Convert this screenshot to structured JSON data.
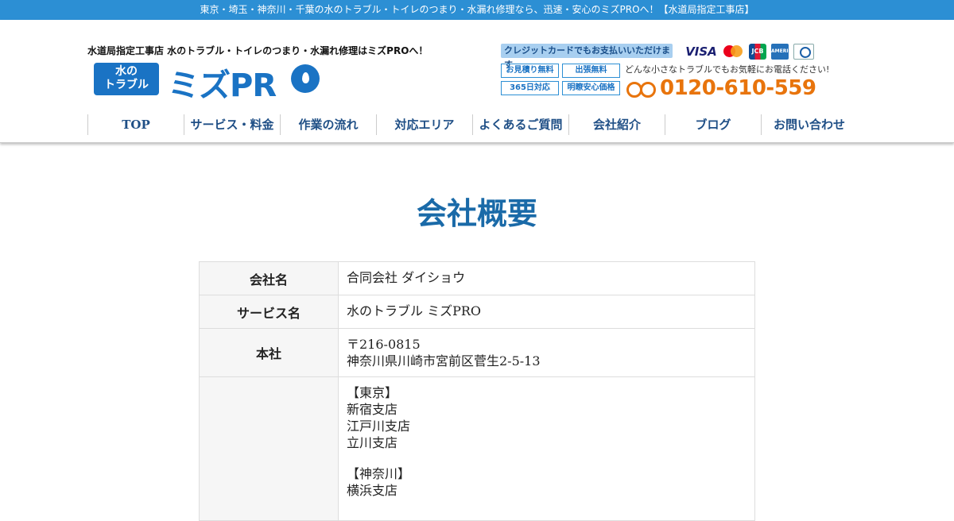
{
  "topbar": {
    "text": "東京・埼玉・神奈川・千葉の水のトラブル・トイレのつまり・水漏れ修理なら、迅速・安心のミズPROへ！【水道局指定工事店】"
  },
  "header": {
    "tagline": "水道局指定工事店 水のトラブル・トイレのつまり・水漏れ修理はミズPROへ！",
    "logo": {
      "box_line1": "水の",
      "box_line2": "トラブル",
      "text": "ミズPR"
    },
    "card_banner": "クレジットカードでもお支払いいただけます",
    "cards": [
      {
        "name": "visa-icon",
        "label": "VISA"
      },
      {
        "name": "mastercard-icon",
        "label": ""
      },
      {
        "name": "jcb-icon",
        "label": "JCB"
      },
      {
        "name": "amex-icon",
        "label": "AMERICAN EXPRESS"
      },
      {
        "name": "diners-icon",
        "label": ""
      }
    ],
    "badges": [
      "お見積り無料",
      "出張無料",
      "365日対応",
      "明瞭安心価格"
    ],
    "phone_note": "どんな小さなトラブルでもお気軽にお電話ください!",
    "phone": "0120-610-559"
  },
  "nav": [
    "TOP",
    "サービス・料金",
    "作業の流れ",
    "対応エリア",
    "よくあるご質問",
    "会社紹介",
    "ブログ",
    "お問い合わせ"
  ],
  "main": {
    "title": "会社概要",
    "rows": [
      {
        "label": "会社名",
        "lines": [
          "合同会社 ダイショウ"
        ]
      },
      {
        "label": "サービス名",
        "lines": [
          "水のトラブル ミズPRO"
        ]
      },
      {
        "label": "本社",
        "lines": [
          "〒216-0815",
          "神奈川県川崎市宮前区菅生2-5-13"
        ]
      }
    ],
    "branches": [
      {
        "region": "【東京】",
        "items": [
          "新宿支店",
          "江戸川支店",
          "立川支店"
        ]
      },
      {
        "region": "【神奈川】",
        "items": [
          "横浜支店"
        ]
      }
    ]
  },
  "colors": {
    "topbar": "#2c8fd4",
    "brand": "#1a73c4",
    "phone": "#e8740c",
    "nav_text": "#1f4f86",
    "title": "#1a6aa8"
  }
}
